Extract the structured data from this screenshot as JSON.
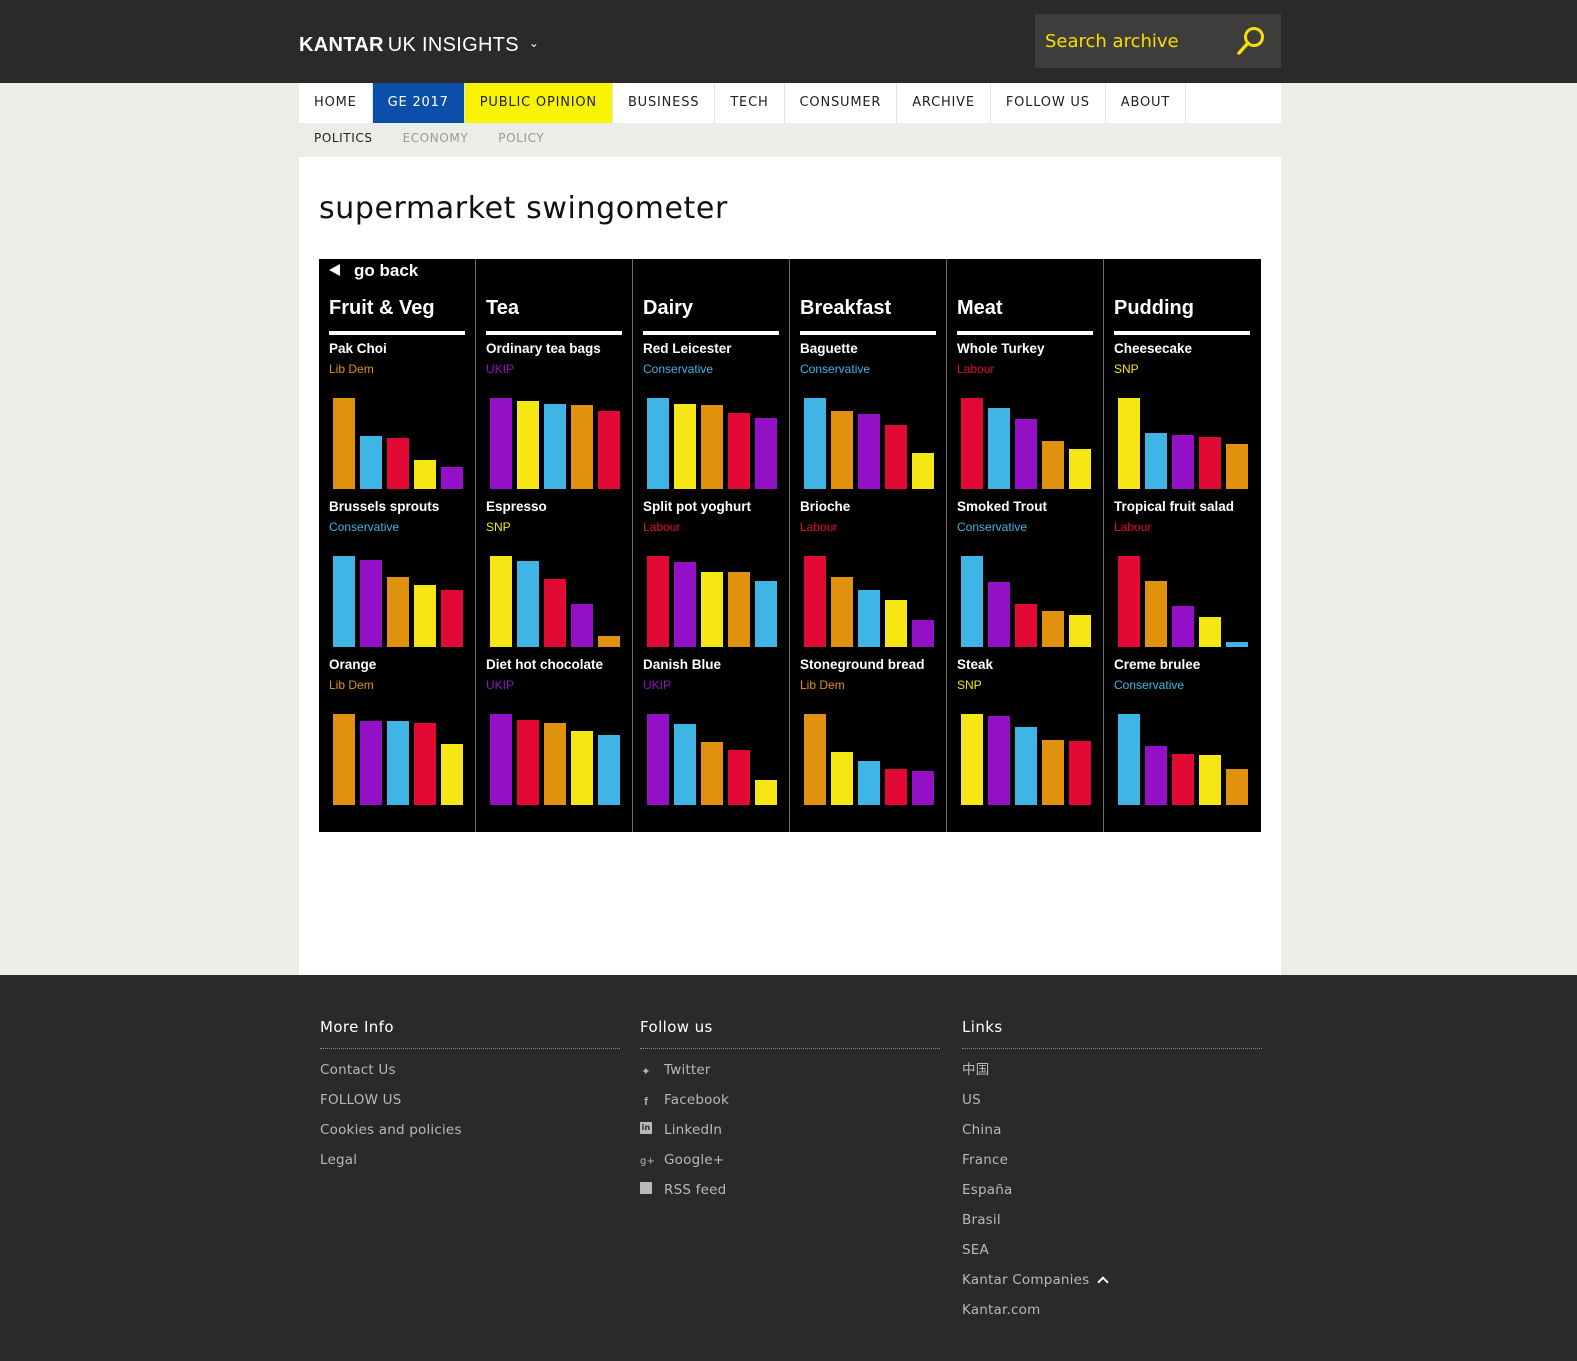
{
  "header": {
    "brand": "KANTAR",
    "brand_sub": "UK INSIGHTS",
    "search_placeholder": "Search archive"
  },
  "nav": {
    "items": [
      "HOME",
      "GE 2017",
      "PUBLIC OPINION",
      "BUSINESS",
      "TECH",
      "CONSUMER",
      "ARCHIVE",
      "FOLLOW US",
      "ABOUT"
    ],
    "sub_items": [
      "POLITICS",
      "ECONOMY",
      "POLICY"
    ]
  },
  "page": {
    "title": "supermarket swingometer",
    "go_back": "go back"
  },
  "colors": {
    "Lib Dem": "#e0920f",
    "Conservative": "#3eb5e5",
    "Labour": "#e20a35",
    "SNP": "#f5e614",
    "UKIP": "#9410c6"
  },
  "chart_data": {
    "type": "bar",
    "parties": [
      "Lib Dem",
      "Conservative",
      "Labour",
      "SNP",
      "UKIP"
    ],
    "categories": [
      {
        "name": "Fruit & Veg",
        "products": [
          {
            "name": "Pak Choi",
            "winner": "Lib Dem",
            "bars": [
              {
                "party": "Lib Dem",
                "value": 95
              },
              {
                "party": "Conservative",
                "value": 55
              },
              {
                "party": "Labour",
                "value": 53
              },
              {
                "party": "SNP",
                "value": 30
              },
              {
                "party": "UKIP",
                "value": 23
              }
            ]
          },
          {
            "name": "Brussels sprouts",
            "winner": "Conservative",
            "bars": [
              {
                "party": "Conservative",
                "value": 95
              },
              {
                "party": "UKIP",
                "value": 91
              },
              {
                "party": "Lib Dem",
                "value": 73
              },
              {
                "party": "SNP",
                "value": 65
              },
              {
                "party": "Labour",
                "value": 59
              }
            ]
          },
          {
            "name": "Orange",
            "winner": "Lib Dem",
            "bars": [
              {
                "party": "Lib Dem",
                "value": 95
              },
              {
                "party": "UKIP",
                "value": 88
              },
              {
                "party": "Conservative",
                "value": 87
              },
              {
                "party": "Labour",
                "value": 85
              },
              {
                "party": "SNP",
                "value": 64
              }
            ]
          }
        ]
      },
      {
        "name": "Tea",
        "products": [
          {
            "name": "Ordinary tea bags",
            "winner": "UKIP",
            "bars": [
              {
                "party": "UKIP",
                "value": 95
              },
              {
                "party": "SNP",
                "value": 92
              },
              {
                "party": "Conservative",
                "value": 89
              },
              {
                "party": "Lib Dem",
                "value": 87
              },
              {
                "party": "Labour",
                "value": 81
              }
            ]
          },
          {
            "name": "Espresso",
            "winner": "SNP",
            "bars": [
              {
                "party": "SNP",
                "value": 95
              },
              {
                "party": "Conservative",
                "value": 90
              },
              {
                "party": "Labour",
                "value": 71
              },
              {
                "party": "UKIP",
                "value": 45
              },
              {
                "party": "Lib Dem",
                "value": 11
              }
            ]
          },
          {
            "name": "Diet hot chocolate",
            "winner": "UKIP",
            "bars": [
              {
                "party": "UKIP",
                "value": 95
              },
              {
                "party": "Labour",
                "value": 89
              },
              {
                "party": "Lib Dem",
                "value": 85
              },
              {
                "party": "SNP",
                "value": 77
              },
              {
                "party": "Conservative",
                "value": 73
              }
            ]
          }
        ]
      },
      {
        "name": "Dairy",
        "products": [
          {
            "name": "Red Leicester",
            "winner": "Conservative",
            "bars": [
              {
                "party": "Conservative",
                "value": 95
              },
              {
                "party": "SNP",
                "value": 89
              },
              {
                "party": "Lib Dem",
                "value": 87
              },
              {
                "party": "Labour",
                "value": 79
              },
              {
                "party": "UKIP",
                "value": 74
              }
            ]
          },
          {
            "name": "Split pot yoghurt",
            "winner": "Labour",
            "bars": [
              {
                "party": "Labour",
                "value": 95
              },
              {
                "party": "UKIP",
                "value": 89
              },
              {
                "party": "SNP",
                "value": 78
              },
              {
                "party": "Lib Dem",
                "value": 78
              },
              {
                "party": "Conservative",
                "value": 69
              }
            ]
          },
          {
            "name": "Danish Blue",
            "winner": "UKIP",
            "bars": [
              {
                "party": "UKIP",
                "value": 95
              },
              {
                "party": "Conservative",
                "value": 84
              },
              {
                "party": "Lib Dem",
                "value": 66
              },
              {
                "party": "Labour",
                "value": 57
              },
              {
                "party": "SNP",
                "value": 26
              }
            ]
          }
        ]
      },
      {
        "name": "Breakfast",
        "products": [
          {
            "name": "Baguette",
            "winner": "Conservative",
            "bars": [
              {
                "party": "Conservative",
                "value": 95
              },
              {
                "party": "Lib Dem",
                "value": 81
              },
              {
                "party": "UKIP",
                "value": 78
              },
              {
                "party": "Labour",
                "value": 67
              },
              {
                "party": "SNP",
                "value": 37
              }
            ]
          },
          {
            "name": "Brioche",
            "winner": "Labour",
            "bars": [
              {
                "party": "Labour",
                "value": 95
              },
              {
                "party": "Lib Dem",
                "value": 73
              },
              {
                "party": "Conservative",
                "value": 59
              },
              {
                "party": "SNP",
                "value": 49
              },
              {
                "party": "UKIP",
                "value": 28
              }
            ]
          },
          {
            "name": "Stoneground bread",
            "winner": "Lib Dem",
            "bars": [
              {
                "party": "Lib Dem",
                "value": 95
              },
              {
                "party": "SNP",
                "value": 55
              },
              {
                "party": "Conservative",
                "value": 46
              },
              {
                "party": "Labour",
                "value": 38
              },
              {
                "party": "UKIP",
                "value": 35
              }
            ]
          }
        ]
      },
      {
        "name": "Meat",
        "products": [
          {
            "name": "Whole Turkey",
            "winner": "Labour",
            "bars": [
              {
                "party": "Labour",
                "value": 95
              },
              {
                "party": "Conservative",
                "value": 84
              },
              {
                "party": "UKIP",
                "value": 73
              },
              {
                "party": "Lib Dem",
                "value": 50
              },
              {
                "party": "SNP",
                "value": 42
              }
            ]
          },
          {
            "name": "Smoked Trout",
            "winner": "Conservative",
            "bars": [
              {
                "party": "Conservative",
                "value": 95
              },
              {
                "party": "UKIP",
                "value": 68
              },
              {
                "party": "Labour",
                "value": 45
              },
              {
                "party": "Lib Dem",
                "value": 37
              },
              {
                "party": "SNP",
                "value": 33
              }
            ]
          },
          {
            "name": "Steak",
            "winner": "SNP",
            "bars": [
              {
                "party": "SNP",
                "value": 95
              },
              {
                "party": "UKIP",
                "value": 93
              },
              {
                "party": "Conservative",
                "value": 81
              },
              {
                "party": "Lib Dem",
                "value": 68
              },
              {
                "party": "Labour",
                "value": 67
              }
            ]
          }
        ]
      },
      {
        "name": "Pudding",
        "products": [
          {
            "name": "Cheesecake",
            "winner": "SNP",
            "bars": [
              {
                "party": "SNP",
                "value": 95
              },
              {
                "party": "Conservative",
                "value": 58
              },
              {
                "party": "UKIP",
                "value": 56
              },
              {
                "party": "Labour",
                "value": 54
              },
              {
                "party": "Lib Dem",
                "value": 47
              }
            ]
          },
          {
            "name": "Tropical fruit salad",
            "winner": "Labour",
            "bars": [
              {
                "party": "Labour",
                "value": 95
              },
              {
                "party": "Lib Dem",
                "value": 69
              },
              {
                "party": "UKIP",
                "value": 43
              },
              {
                "party": "SNP",
                "value": 31
              },
              {
                "party": "Conservative",
                "value": 5
              }
            ]
          },
          {
            "name": "Creme brulee",
            "winner": "Conservative",
            "bars": [
              {
                "party": "Conservative",
                "value": 95
              },
              {
                "party": "UKIP",
                "value": 61
              },
              {
                "party": "Labour",
                "value": 53
              },
              {
                "party": "SNP",
                "value": 52
              },
              {
                "party": "Lib Dem",
                "value": 37
              }
            ]
          }
        ]
      }
    ]
  },
  "footer": {
    "more_info": {
      "title": "More Info",
      "items": [
        "Contact Us",
        "FOLLOW US",
        "Cookies and policies",
        "Legal"
      ]
    },
    "follow_us": {
      "title": "Follow us",
      "items": [
        {
          "icon": "twitter-icon",
          "label": "Twitter"
        },
        {
          "icon": "facebook-icon",
          "label": "Facebook"
        },
        {
          "icon": "linkedin-icon",
          "label": "LinkedIn"
        },
        {
          "icon": "google-plus-icon",
          "label": "Google+"
        },
        {
          "icon": "rss-icon",
          "label": "RSS feed"
        }
      ]
    },
    "links": {
      "title": "Links",
      "items": [
        "中国",
        "US",
        "China",
        "France",
        "España",
        "Brasil",
        "SEA",
        "Kantar Companies",
        "Kantar.com"
      ]
    }
  }
}
